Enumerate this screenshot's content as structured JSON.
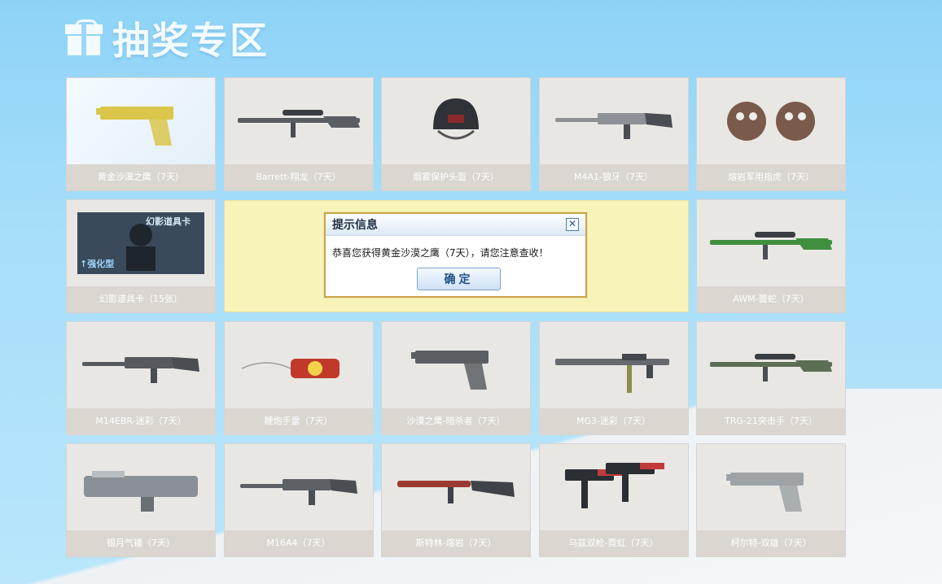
{
  "header": {
    "title": "抽奖专区",
    "icon": "gift-icon"
  },
  "prizes": [
    {
      "label": "黄金沙漠之鹰（7天）",
      "kind": "pistol",
      "color": "#d9c64b",
      "selected": true
    },
    {
      "label": "Barrett-翔龙（7天）",
      "kind": "sniper",
      "color": "#5a5d62"
    },
    {
      "label": "烟雾保护头盔（7天）",
      "kind": "helmet",
      "color": "#2f3236"
    },
    {
      "label": "M4A1-狼牙（7天）",
      "kind": "rifle",
      "color": "#8d9196"
    },
    {
      "label": "熔岩军用指虎（7天）",
      "kind": "knuckles",
      "color": "#7a5a4a"
    },
    {
      "label": "幻影道具卡（15张）",
      "kind": "card",
      "color": "#3a4a5a",
      "card_title": "幻影道具卡",
      "card_tag": "强化型"
    },
    {
      "label": "AWM-蕾蛇（7天）",
      "kind": "sniper",
      "color": "#3f8f3f"
    },
    {
      "label": "M14EBR-迷彩（7天）",
      "kind": "rifle",
      "color": "#56595d"
    },
    {
      "label": "鞭炮手雷（7天）",
      "kind": "firecracker",
      "color": "#c0392b"
    },
    {
      "label": "沙漠之鹰-暗杀者（7天）",
      "kind": "pistol",
      "color": "#5b5f64"
    },
    {
      "label": "MG3-迷彩（7天）",
      "kind": "mg",
      "color": "#666a6e"
    },
    {
      "label": "TRG-21突击手（7天）",
      "kind": "sniper",
      "color": "#5c6f55"
    },
    {
      "label": "银月气锤（7天）",
      "kind": "hammer",
      "color": "#8a9096"
    },
    {
      "label": "M16A4（7天）",
      "kind": "rifle",
      "color": "#5d6166"
    },
    {
      "label": "斯特林-熔岩（7天）",
      "kind": "smg",
      "color": "#9a3a30"
    },
    {
      "label": "乌兹双枪-霓虹（7天）",
      "kind": "uzi",
      "color": "#c23a3a"
    },
    {
      "label": "柯尔特-双雄（7天）",
      "kind": "pistol",
      "color": "#9ea3a8"
    }
  ],
  "dialog": {
    "title": "提示信息",
    "close_label": "✕",
    "message": "恭喜您获得黄金沙漠之鹰（7天），请您注意查收！",
    "ok_label": "确定"
  }
}
